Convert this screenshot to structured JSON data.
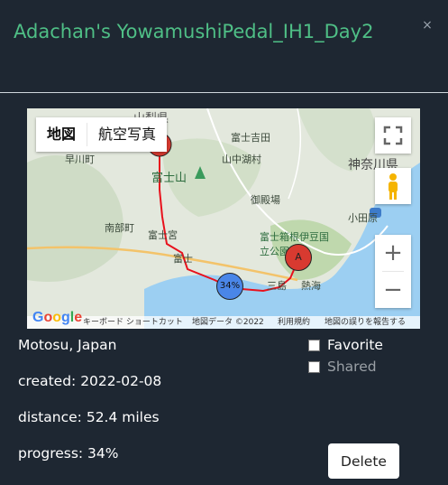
{
  "modal": {
    "title": "Adachan's YowamushiPedal_IH1_Day2",
    "close_symbol": "×"
  },
  "map": {
    "type_buttons": [
      "地図",
      "航空写真"
    ],
    "labels": [
      "山梨県",
      "富士吉田",
      "早川町",
      "山中湖村",
      "神奈川県",
      "富士山",
      "南部町",
      "富士宮",
      "御殿場",
      "小田原",
      "富士",
      "富士箱根伊豆国立公園",
      "三島",
      "熱海"
    ],
    "markers": {
      "start": "A",
      "progress": "34%"
    },
    "attribution": {
      "logo": "Google",
      "shortcuts": "キーボード ショートカット",
      "data": "地図データ ©2022",
      "terms": "利用規約",
      "report": "地図の誤りを報告する"
    },
    "zoom_in": "+",
    "zoom_out": "−",
    "colors": {
      "route": "#e8111c",
      "marker_a": "#d83a30",
      "marker_progress": "#4a86e8",
      "sea": "#9ccff2"
    }
  },
  "details": {
    "location": "Motosu, Japan",
    "created": "created: 2022-02-08",
    "distance": "distance: 52.4 miles",
    "progress": "progress: 34%"
  },
  "options": {
    "favorite": "Favorite",
    "shared": "Shared"
  },
  "actions": {
    "delete": "Delete"
  }
}
